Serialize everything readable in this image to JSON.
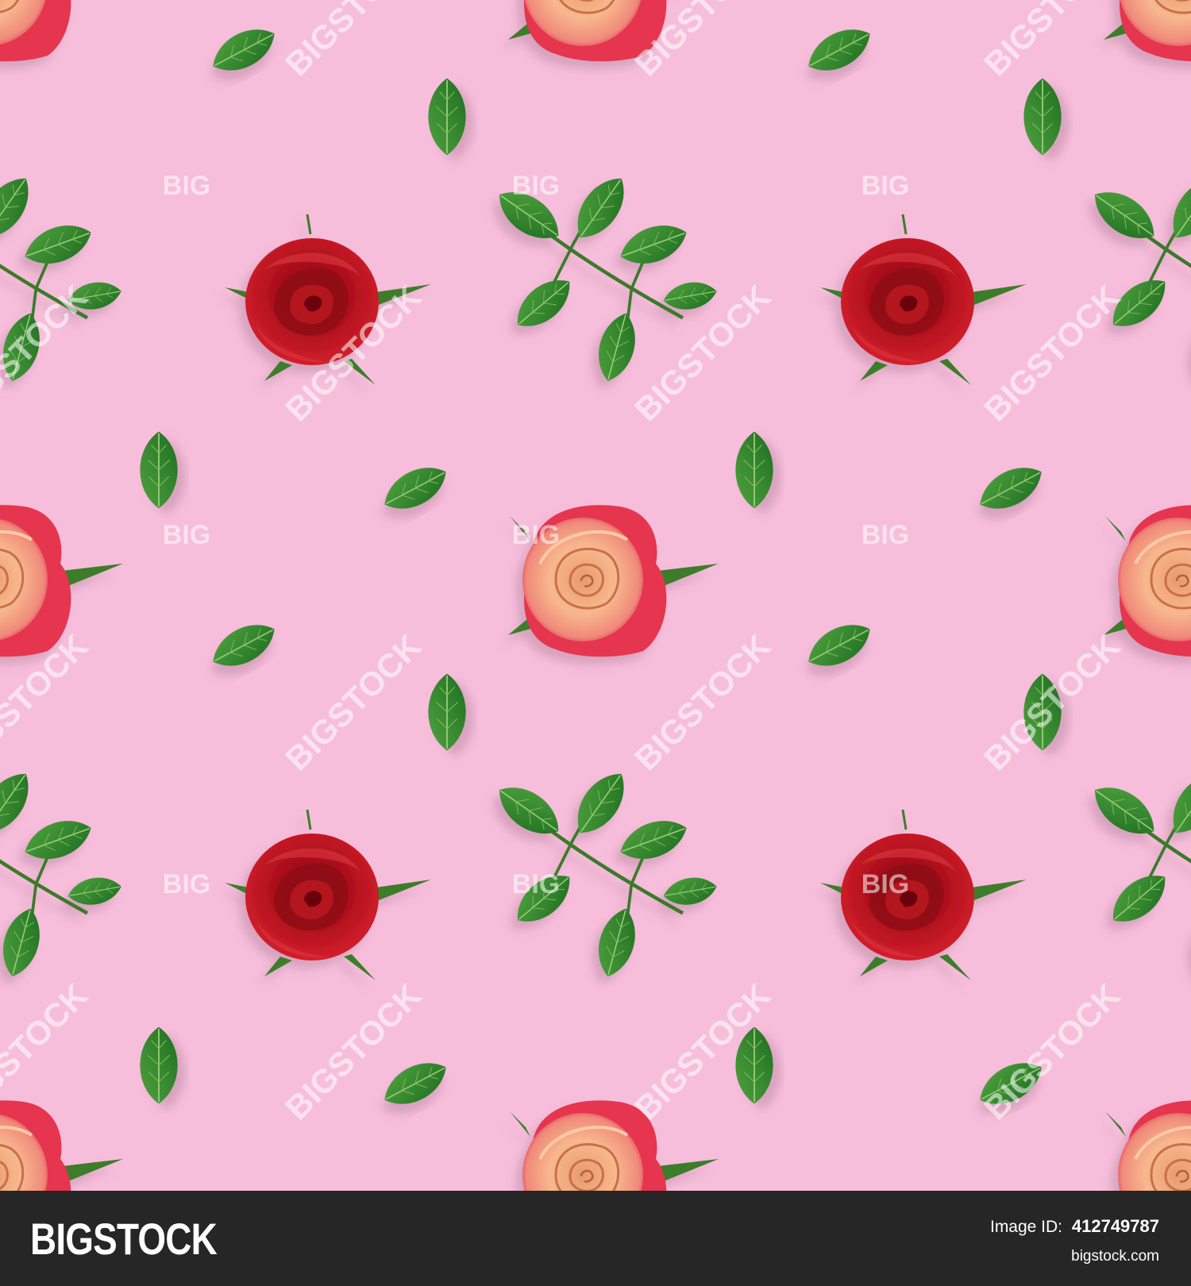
{
  "background_color": "#f7bedb",
  "watermark": {
    "diagonal_text": "BIGSTOCK",
    "small_text": "BIG"
  },
  "footer": {
    "logo": "BIGSTOCK",
    "image_id_label": "Image ID:",
    "image_id": "412749787",
    "site": "bigstock.com"
  },
  "objects": {
    "red_rose": "red rose head",
    "peach_rose": "peach-pink rose head",
    "leaf_sprig": "rose leaf sprig",
    "single_leaf": "single green leaf"
  },
  "colors": {
    "red_rose": "#b0101c",
    "peach_rose": "#f2a27c",
    "peach_rose_edge": "#e0314f",
    "leaf": "#2f8a2a",
    "leaf_dark": "#1c6a1f",
    "footer_bg": "#262626"
  }
}
